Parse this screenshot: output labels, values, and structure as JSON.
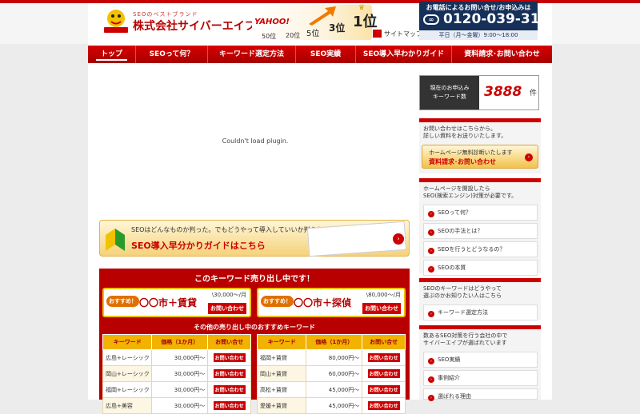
{
  "header": {
    "logo_sub": "SEOのベストブランド",
    "company_name": "株式会社サイバーエイプ",
    "hero": {
      "search_engine": "YAHOO!",
      "ranks": [
        "50位",
        "20位",
        "5位",
        "3位",
        "1位"
      ]
    },
    "sitemap": "サイトマップ",
    "phone": {
      "caption": "お電話によるお問い合せ/お申込みは",
      "number": "0120-039-318",
      "hours": "平日（月〜金曜）9:00〜18:00",
      "icon": "free-dial-icon"
    }
  },
  "nav": {
    "items": [
      "トップ",
      "SEOって何？",
      "キーワード選定方法",
      "SEO実績",
      "SEO導入早わかりガイド",
      "資料請求･お問い合わせ"
    ]
  },
  "main": {
    "plugin_message": "Couldn't load plugin.",
    "banner": {
      "line1": "SEOはどんなものか判った。でもどうやって導入していいか判らない。そんな人へ…",
      "line2": "SEO導入早分かりガイドはこちら"
    },
    "sale": {
      "title": "このキーワード売り出し中です！",
      "cards": [
        {
          "badge": "おすすめ！",
          "keyword": "〇〇市＋賃貸",
          "price": "\\30,000〜/月",
          "button": "お問い合わせ"
        },
        {
          "badge": "おすすめ！",
          "keyword": "〇〇市＋探偵",
          "price": "\\80,000〜/月",
          "button": "お問い合わせ"
        }
      ],
      "other_title": "その他の売り出し中のおすすめキーワード",
      "columns": [
        "キーワード",
        "価格（1か月）",
        "お問い合せ"
      ],
      "button_label": "お問い合わせ",
      "left_rows": [
        {
          "keyword": "広島+レーシック",
          "price": "30,000円〜"
        },
        {
          "keyword": "岡山+レーシック",
          "price": "30,000円〜"
        },
        {
          "keyword": "福岡+レーシック",
          "price": "30,000円〜"
        },
        {
          "keyword": "広島+美容",
          "price": "30,000円〜"
        }
      ],
      "right_rows": [
        {
          "keyword": "福岡+賃貸",
          "price": "80,000円〜"
        },
        {
          "keyword": "岡山+賃貸",
          "price": "60,000円〜"
        },
        {
          "keyword": "高松+賃貸",
          "price": "45,000円〜"
        },
        {
          "keyword": "愛媛+賃貸",
          "price": "45,000円〜"
        }
      ]
    }
  },
  "sidebar": {
    "counter": {
      "label_line1": "現在のお申込み",
      "label_line2": "キーワード数",
      "value": "3888",
      "unit": "件"
    },
    "contact": {
      "text1": "お問い合わせはこちらから。",
      "text2": "詳しい資料をお送りいたします。",
      "banner_line1": "ホームページ無料診断いたします",
      "banner_line2": "資料請求･お問い合わせ"
    },
    "seo": {
      "text1": "ホームページを開設したら",
      "text2": "SEO(検索エンジン)対策が必要です。",
      "items": [
        "SEOって何？",
        "SEOの手法とは？",
        "SEOを行うとどうなるの？",
        "SEOの本質"
      ]
    },
    "keyword": {
      "text1": "SEOのキーワードはどうやって",
      "text2": "選ぶのかお知りたい人はこちら",
      "items": [
        "キーワード選定方法"
      ]
    },
    "reason": {
      "text1": "数あるSEO対策を行う会社の中で",
      "text2": "サイバーエイプが選ばれています",
      "items": [
        "SEO実績",
        "事例紹介",
        "選ばれる理由"
      ]
    }
  }
}
